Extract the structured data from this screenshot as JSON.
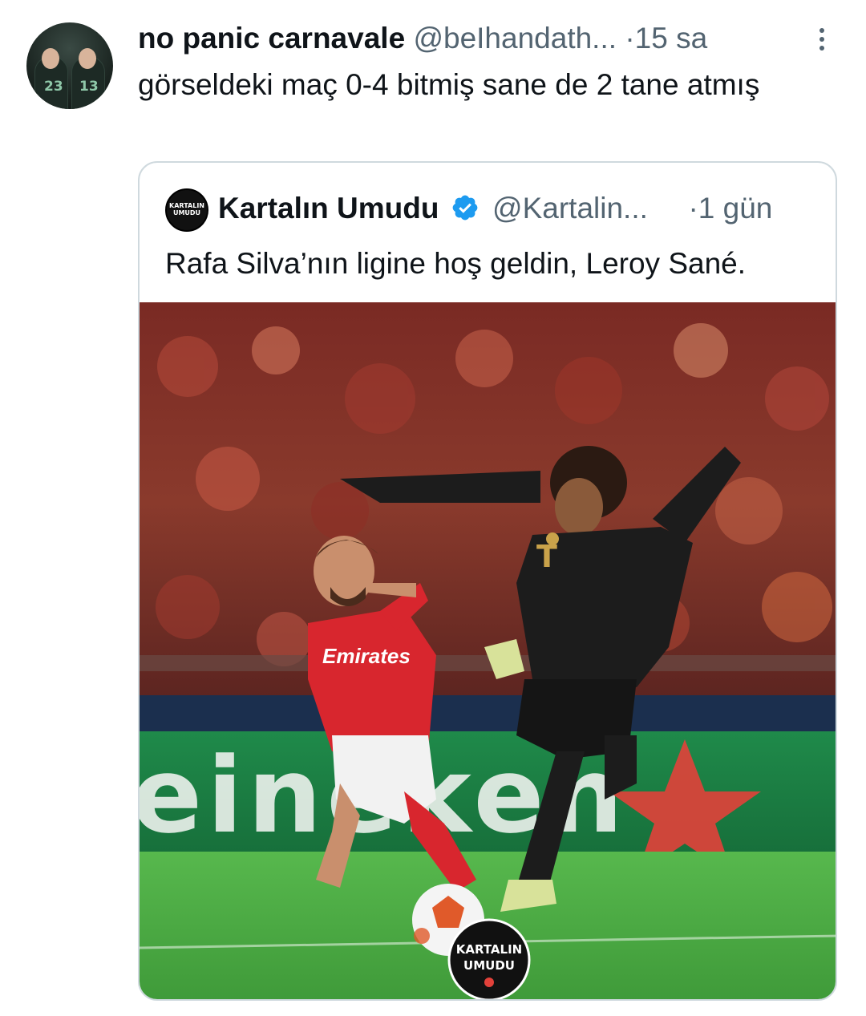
{
  "tweet": {
    "author": {
      "display_name": "no panic carnavale",
      "handle": "@beIhandath...",
      "avatar": "profile-photo",
      "avatar_numbers": [
        "23",
        "13"
      ]
    },
    "separator": "·",
    "time": "15 sa",
    "text": "görseldeki maç 0-4 bitmiş sane de 2 tane atmış",
    "more_icon": "more-vertical-icon"
  },
  "quoted": {
    "author": {
      "display_name": "Kartalın Umudu",
      "handle": "@Kartalin...",
      "verified": true,
      "verified_color": "#1d9bf0",
      "avatar_text": [
        "KARTALIN",
        "UMUDU"
      ]
    },
    "separator": "·",
    "time": "1 gün",
    "text": "Rafa Silva’nın ligine hoş geldin, Leroy Sané.",
    "media": {
      "kind": "photo",
      "board_text": "eineken",
      "shirt_sponsor": "Emirates",
      "shirt_sponsor_display": "Emirates",
      "watermark": [
        "KARTALIN",
        "UMUDU"
      ]
    }
  },
  "colors": {
    "text_primary": "#0f1419",
    "text_secondary": "#536471",
    "border": "#cfd9de",
    "accent": "#1d9bf0"
  }
}
